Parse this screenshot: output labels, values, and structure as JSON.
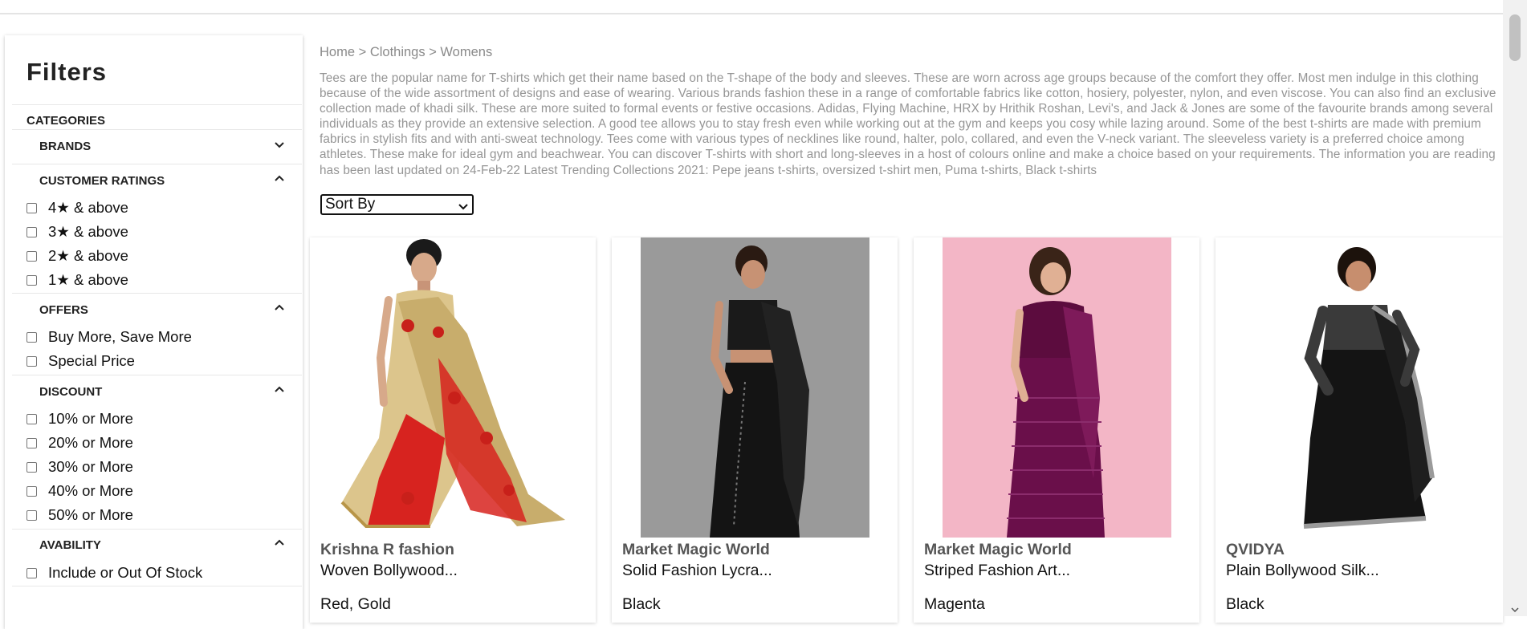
{
  "sidebar": {
    "title": "Filters",
    "categories_label": "CATEGORIES",
    "sections": {
      "brands": {
        "label": "BRANDS",
        "expanded": false
      },
      "ratings": {
        "label": "CUSTOMER RATINGS",
        "expanded": true,
        "options": [
          "4★ & above",
          "3★ & above",
          "2★ & above",
          "1★ & above"
        ]
      },
      "offers": {
        "label": "OFFERS",
        "expanded": true,
        "options": [
          "Buy More, Save More",
          "Special Price"
        ]
      },
      "discount": {
        "label": "DISCOUNT",
        "expanded": true,
        "options": [
          "10% or More",
          "20% or More",
          "30% or More",
          "40% or More",
          "50% or More"
        ]
      },
      "availability": {
        "label": "AVABILITY",
        "expanded": true,
        "options": [
          "Include or Out Of Stock"
        ]
      }
    }
  },
  "main": {
    "breadcrumb": "Home > Clothings > Womens",
    "description": "Tees are the popular name for T-shirts which get their name based on the T-shape of the body and sleeves. These are worn across age groups because of the comfort they offer. Most men indulge in this clothing because of the wide assortment of designs and ease of wearing. Various brands fashion these in a range of comfortable fabrics like cotton, hosiery, polyester, nylon, and even viscose. You can also find an exclusive collection made of khadi silk. These are more suited to formal events or festive occasions. Adidas, Flying Machine, HRX by Hrithik Roshan, Levi's, and Jack & Jones are some of the favourite brands among several individuals as they provide an extensive selection. A good tee allows you to stay fresh even while working out at the gym and keeps you cosy while lazing around. Some of the best t-shirts are made with premium fabrics in stylish fits and with anti-sweat technology. Tees come with various types of necklines like round, halter, polo, collared, and even the V-neck variant. The sleeveless variety is a preferred choice among athletes. These make for ideal gym and beachwear. You can discover T-shirts with short and long-sleeves in a host of colours online and make a choice based on your requirements. The information you are reading has been last updated on 24-Feb-22 Latest Trending Collections 2021: Pepe jeans t-shirts, oversized t-shirt men, Puma t-shirts, Black t-shirts",
    "sort_label": "Sort By",
    "products": [
      {
        "brand": "Krishna R fashion",
        "name": "Woven Bollywood...",
        "color": "Red, Gold",
        "image": "saree-red-gold"
      },
      {
        "brand": "Market Magic World",
        "name": "Solid Fashion Lycra...",
        "color": "Black",
        "image": "saree-black-grey-bg"
      },
      {
        "brand": "Market Magic World",
        "name": "Striped Fashion Art...",
        "color": "Magenta",
        "image": "saree-magenta-pink-bg"
      },
      {
        "brand": "QVIDYA",
        "name": "Plain Bollywood Silk...",
        "color": "Black",
        "image": "saree-black-silver-border"
      }
    ]
  },
  "colors": {
    "saree_red": "#d7231f",
    "saree_gold": "#dcc58c",
    "bg_grey": "#979797",
    "bg_pink": "#f4b8c8",
    "magenta": "#6a0f4a",
    "black": "#141414",
    "silver": "#9a9a9a"
  }
}
